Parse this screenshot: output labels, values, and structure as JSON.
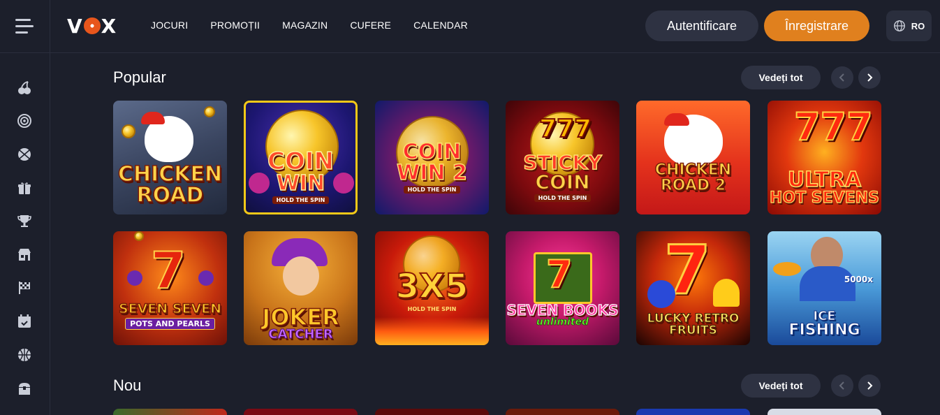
{
  "header": {
    "logo": "VOX",
    "nav": [
      "JOCURI",
      "PROMOȚII",
      "MAGAZIN",
      "CUFERE",
      "CALENDAR"
    ],
    "login_label": "Autentificare",
    "register_label": "Înregistrare",
    "language": "RO"
  },
  "sidebar": {
    "icons": [
      "cherries-icon",
      "target-icon",
      "basketball-icon",
      "gift-icon",
      "trophy-icon",
      "store-icon",
      "race-flag-icon",
      "calendar-icon",
      "ball-icon",
      "chest-icon"
    ]
  },
  "sections": [
    {
      "title": "Popular",
      "see_all": "Vedeți tot",
      "games": [
        {
          "line1": "CHICKEN",
          "line2": "ROAD",
          "sub": ""
        },
        {
          "line1": "COIN",
          "line2": "WIN",
          "sub": "HOLD THE SPIN"
        },
        {
          "line1": "COIN",
          "line2": "WIN 2",
          "sub": "HOLD THE SPIN"
        },
        {
          "line1": "STICKY",
          "line2": "COIN",
          "sub": "HOLD THE SPIN"
        },
        {
          "line1": "CHICKEN",
          "line2": "ROAD 2",
          "sub": ""
        },
        {
          "line1": "ULTRA",
          "line2": "HOT SEVENS",
          "sub": ""
        },
        {
          "line1": "SEVEN SEVEN",
          "line2": "",
          "sub": "POTS AND PEARLS"
        },
        {
          "line1": "JOKER",
          "line2": "CATCHER",
          "sub": ""
        },
        {
          "line1": "3X5",
          "line2": "",
          "sub": "HOLD THE SPIN"
        },
        {
          "line1": "SEVEN BOOKS",
          "line2": "unlimited",
          "sub": ""
        },
        {
          "line1": "LUCKY RETRO",
          "line2": "FRUITS",
          "sub": ""
        },
        {
          "line1": "ICE",
          "line2": "FISHING",
          "sub": "5000x"
        }
      ]
    },
    {
      "title": "Nou",
      "see_all": "Vedeți tot"
    }
  ],
  "colors": {
    "background": "#1c1f2b",
    "button": "#2e3242",
    "accent": "#e0801e"
  }
}
